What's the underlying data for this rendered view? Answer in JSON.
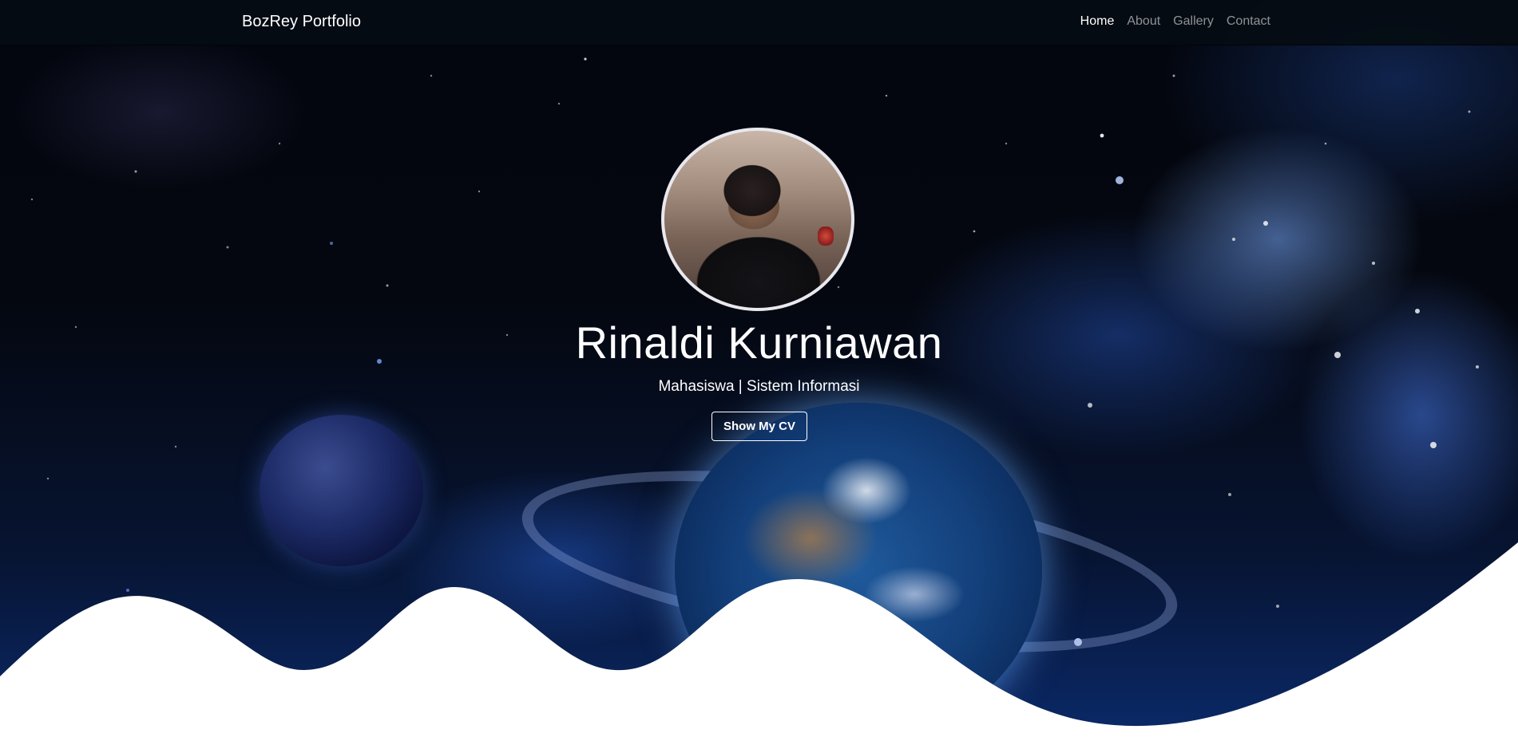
{
  "navbar": {
    "brand": "BozRey Portfolio",
    "links": [
      {
        "label": "Home",
        "active": true
      },
      {
        "label": "About",
        "active": false
      },
      {
        "label": "Gallery",
        "active": false
      },
      {
        "label": "Contact",
        "active": false
      }
    ]
  },
  "hero": {
    "name": "Rinaldi Kurniawan",
    "subtitle": "Mahasiswa | Sistem Informasi",
    "cv_button": "Show My CV"
  },
  "colors": {
    "navbar_bg": "#050c12",
    "text": "#ffffff",
    "nav_inactive": "rgba(255,255,255,0.55)",
    "space_blue": "#0b2a6a",
    "wave_fill": "#ffffff"
  }
}
